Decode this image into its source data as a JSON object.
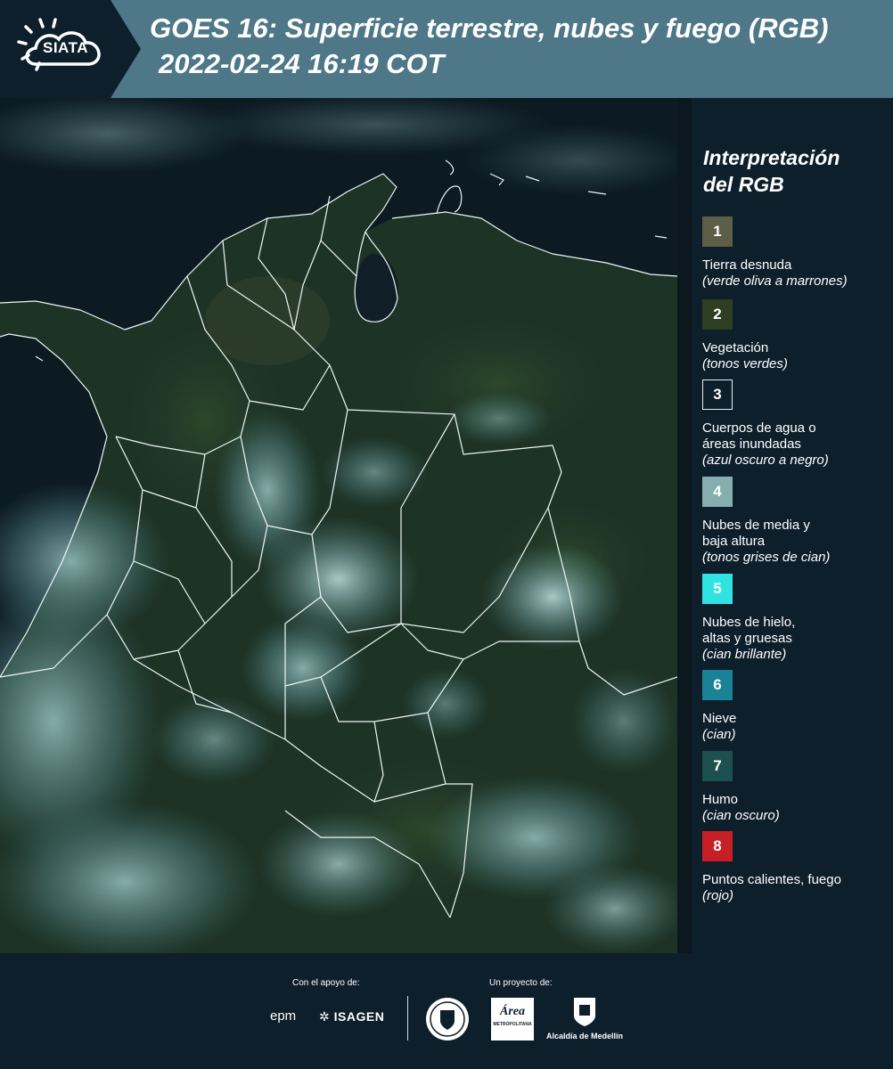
{
  "header": {
    "logo_text": "SIATA",
    "title": "GOES 16: Superficie terrestre, nubes y fuego (RGB)",
    "subtitle": "2022-02-24 16:19 COT"
  },
  "legend": {
    "title_line1": "Interpretación",
    "title_line2": "del RGB",
    "items": [
      {
        "number": "1",
        "color": "#5c5e45",
        "label": "Tierra desnuda",
        "desc": "(verde oliva a marrones)"
      },
      {
        "number": "2",
        "color": "#2e3e20",
        "label": "Vegetación",
        "desc": "(tonos verdes)"
      },
      {
        "number": "3",
        "color": "#0d1f2b",
        "label": "Cuerpos de agua o áreas inundadas",
        "desc": "(azul oscuro a negro)"
      },
      {
        "number": "4",
        "color": "#87aeaf",
        "label": "Nubes de media y baja altura",
        "desc": "(tonos grises de cian)"
      },
      {
        "number": "5",
        "color": "#2fe3e3",
        "label": "Nubes de hielo, altas y gruesas",
        "desc": "(cian brillante)"
      },
      {
        "number": "6",
        "color": "#1a8296",
        "label": "Nieve",
        "desc": "(cian)"
      },
      {
        "number": "7",
        "color": "#1d504f",
        "label": "Humo",
        "desc": "(cian oscuro)"
      },
      {
        "number": "8",
        "color": "#c62026",
        "label": "Puntos calientes, fuego",
        "desc": "(rojo)"
      }
    ]
  },
  "footer": {
    "support_label": "Con el apoyo de:",
    "project_label": "Un proyecto de:",
    "epm_logo": "epm",
    "isagen_logo": "ISAGEN",
    "area_logo": "Área",
    "area_logo_sub": "METROPOLITANA",
    "alcaldia_logo": "Alcaldía de Medellín"
  },
  "icons": {
    "logo": "sun-cloud-icon",
    "seal": "university-seal-icon",
    "coat": "coat-of-arms-icon"
  }
}
